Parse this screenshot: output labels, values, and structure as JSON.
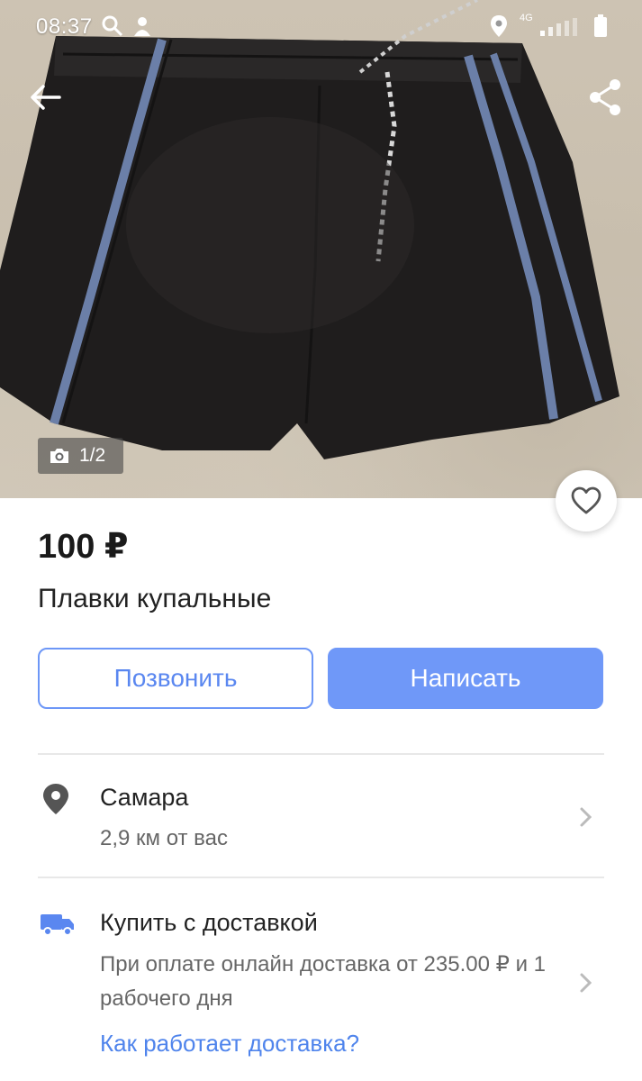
{
  "status_bar": {
    "time": "08:37",
    "network": "4G",
    "icons": [
      "search-icon",
      "notification-icon",
      "location-icon",
      "signal-icon",
      "battery-icon"
    ]
  },
  "hero": {
    "photo_counter": "1/2",
    "icons": [
      "back-arrow-icon",
      "share-icon",
      "camera-icon",
      "heart-icon"
    ]
  },
  "listing": {
    "price": "100 ₽",
    "title": "Плавки купальные"
  },
  "actions": {
    "call_label": "Позвонить",
    "write_label": "Написать"
  },
  "location": {
    "city": "Самара",
    "distance": "2,9 км от вас"
  },
  "delivery": {
    "title": "Купить с доставкой",
    "description": "При оплате онлайн доставка от 235.00 ₽ и 1 рабочего дня",
    "link": "Как работает доставка?"
  },
  "colors": {
    "accent": "#6f98f8",
    "link": "#4f84ec",
    "text_primary": "#222222",
    "text_secondary": "#666666"
  }
}
